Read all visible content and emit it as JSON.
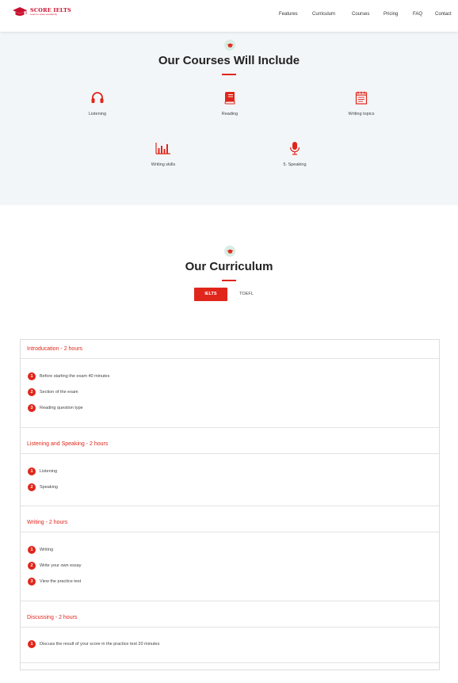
{
  "brand": {
    "name": "SCORE IELTS",
    "tagline": "Learn to score excellently",
    "accent_color": "#e0261b",
    "logo_icon": "graduation-cap-icon"
  },
  "nav": {
    "items": [
      "Features",
      "Curriculum",
      "Courses",
      "Pricing",
      "FAQ",
      "Contact"
    ]
  },
  "courses_section": {
    "badge_icon": "graduation-cap-icon",
    "title": "Our Courses Will Include",
    "items": [
      {
        "label": "Listening",
        "icon": "headphones-icon"
      },
      {
        "label": "Reading",
        "icon": "book-icon"
      },
      {
        "label": "Writing topics",
        "icon": "notepad-icon"
      },
      {
        "label": "Writing skills",
        "icon": "bar-chart-icon"
      },
      {
        "label": "5. Speaking",
        "icon": "microphone-icon"
      }
    ]
  },
  "curriculum_section": {
    "badge_icon": "graduation-cap-icon",
    "title": "Our Curriculum",
    "tabs": [
      {
        "label": "IELTS",
        "active": true
      },
      {
        "label": "TOEFL",
        "active": false
      }
    ],
    "modules": [
      {
        "title": "Introducation - 2 hours",
        "lessons": [
          "Before starting the exam 40 minutes",
          "Section of the exam",
          "Reading question type"
        ]
      },
      {
        "title": "Listening and Speaking - 2 hours",
        "lessons": [
          "Listening",
          "Speaking"
        ]
      },
      {
        "title": "Writing - 2 hours",
        "lessons": [
          "Writing",
          "Write your own essay",
          "View the practice test"
        ]
      },
      {
        "title": "Discussing - 2 hours",
        "lessons": [
          "Discuss the result of your score in the practice test 20 minutes"
        ]
      }
    ]
  }
}
